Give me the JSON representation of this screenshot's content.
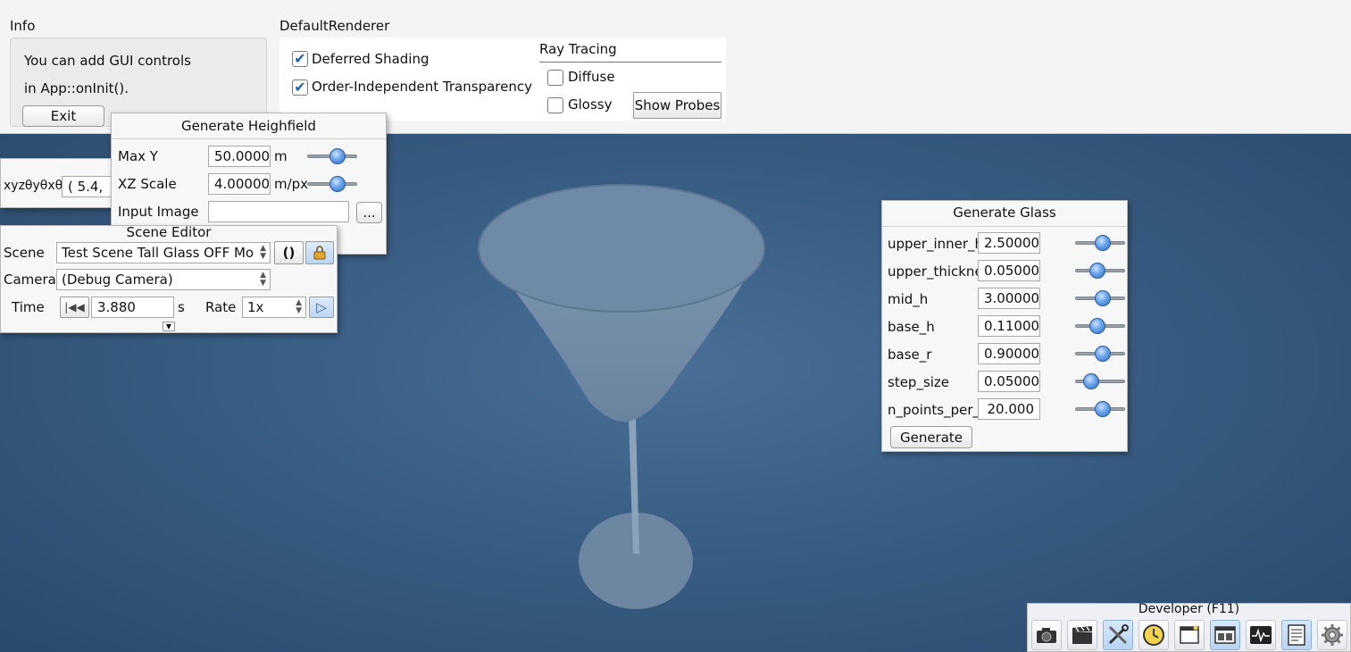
{
  "viewport": {
    "background": "#35577a"
  },
  "info": {
    "title": "Info",
    "line1": "You can add GUI controls",
    "line2": "in App::onInit().",
    "exit_label": "Exit"
  },
  "renderer": {
    "title": "DefaultRenderer",
    "deferred_shading": {
      "label": "Deferred Shading",
      "checked": true
    },
    "oit": {
      "label": "Order-Independent Transparency",
      "checked": true
    },
    "ray_tracing": {
      "title": "Ray Tracing",
      "diffuse": {
        "label": "Diffuse",
        "checked": false
      },
      "glossy": {
        "label": "Glossy",
        "checked": false
      },
      "show_probes_label": "Show Probes"
    }
  },
  "camera_panel": {
    "label": "xyzθyθxθz",
    "value": "( 5.4,"
  },
  "heightfield": {
    "title": "Generate Heighfield",
    "rows": [
      {
        "label": "Max Y",
        "value": "50.0000",
        "unit": "m",
        "slider": 0.62
      },
      {
        "label": "XZ Scale",
        "value": "4.00000",
        "unit": "m/px",
        "slider": 0.62
      }
    ],
    "input_image_label": "Input Image",
    "input_image_value": "",
    "browse_label": "..."
  },
  "scene_editor": {
    "title": "Scene Editor",
    "scene_label": "Scene",
    "scene_value": "Test Scene Tall Glass OFF Mo",
    "camera_label": "Camera",
    "camera_value": "(Debug Camera)",
    "time_label": "Time",
    "time_value": "3.880",
    "time_unit": "s",
    "rate_label": "Rate",
    "rate_value": "1x"
  },
  "glass": {
    "title": "Generate Glass",
    "rows": [
      {
        "label": "upper_inner_h",
        "value": "2.50000",
        "slider": 0.55
      },
      {
        "label": "upper_thickness",
        "value": "0.05000",
        "slider": 0.4
      },
      {
        "label": "mid_h",
        "value": "3.00000",
        "slider": 0.55
      },
      {
        "label": "base_h",
        "value": "0.11000",
        "slider": 0.42
      },
      {
        "label": "base_r",
        "value": "0.90000",
        "slider": 0.55
      },
      {
        "label": "step_size",
        "value": "0.05000",
        "slider": 0.32
      },
      {
        "label": "n_points_per_loop",
        "value": "20.000",
        "slider": 0.55
      }
    ],
    "generate_label": "Generate"
  },
  "developer": {
    "title": "Developer (F11)",
    "icons": [
      "camera-icon",
      "clapperboard-icon",
      "tools-icon",
      "clock-icon",
      "window-icon",
      "scene-icon",
      "profiler-icon",
      "document-icon",
      "gear-icon"
    ]
  }
}
